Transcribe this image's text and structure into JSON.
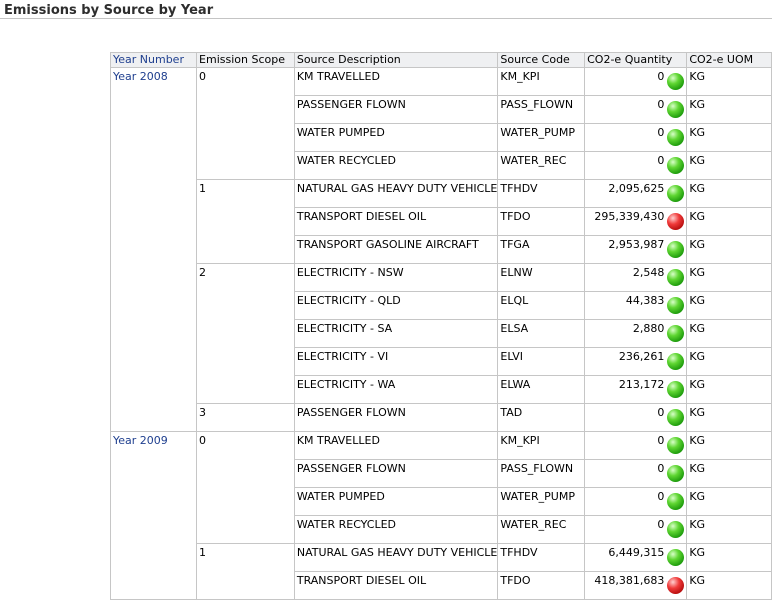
{
  "report": {
    "title": "Emissions by Source by Year"
  },
  "columns": [
    "Year Number",
    "Emission Scope",
    "Source Description",
    "Source Code",
    "CO2-e Quantity",
    "CO2-e UOM"
  ],
  "status_colors": {
    "green": "#3fbf1f",
    "red": "#e02020"
  },
  "groups": [
    {
      "year": "Year 2008",
      "scopes": [
        {
          "scope": "0",
          "rows": [
            {
              "desc": "KM TRAVELLED",
              "code": "KM_KPI",
              "qty": "0",
              "status": "green",
              "uom": "KG"
            },
            {
              "desc": "PASSENGER FLOWN",
              "code": "PASS_FLOWN",
              "qty": "0",
              "status": "green",
              "uom": "KG"
            },
            {
              "desc": "WATER PUMPED",
              "code": "WATER_PUMP",
              "qty": "0",
              "status": "green",
              "uom": "KG"
            },
            {
              "desc": "WATER RECYCLED",
              "code": "WATER_REC",
              "qty": "0",
              "status": "green",
              "uom": "KG"
            }
          ]
        },
        {
          "scope": "1",
          "rows": [
            {
              "desc": "NATURAL GAS HEAVY DUTY VEHICLE",
              "code": "TFHDV",
              "qty": "2,095,625",
              "status": "green",
              "uom": "KG"
            },
            {
              "desc": "TRANSPORT DIESEL OIL",
              "code": "TFDO",
              "qty": "295,339,430",
              "status": "red",
              "uom": "KG"
            },
            {
              "desc": "TRANSPORT GASOLINE AIRCRAFT",
              "code": "TFGA",
              "qty": "2,953,987",
              "status": "green",
              "uom": "KG"
            }
          ]
        },
        {
          "scope": "2",
          "rows": [
            {
              "desc": "ELECTRICITY - NSW",
              "code": "ELNW",
              "qty": "2,548",
              "status": "green",
              "uom": "KG"
            },
            {
              "desc": "ELECTRICITY - QLD",
              "code": "ELQL",
              "qty": "44,383",
              "status": "green",
              "uom": "KG"
            },
            {
              "desc": "ELECTRICITY - SA",
              "code": "ELSA",
              "qty": "2,880",
              "status": "green",
              "uom": "KG"
            },
            {
              "desc": "ELECTRICITY - VI",
              "code": "ELVI",
              "qty": "236,261",
              "status": "green",
              "uom": "KG"
            },
            {
              "desc": "ELECTRICITY - WA",
              "code": "ELWA",
              "qty": "213,172",
              "status": "green",
              "uom": "KG"
            }
          ]
        },
        {
          "scope": "3",
          "rows": [
            {
              "desc": "PASSENGER FLOWN",
              "code": "TAD",
              "qty": "0",
              "status": "green",
              "uom": "KG"
            }
          ]
        }
      ]
    },
    {
      "year": "Year 2009",
      "scopes": [
        {
          "scope": "0",
          "rows": [
            {
              "desc": "KM TRAVELLED",
              "code": "KM_KPI",
              "qty": "0",
              "status": "green",
              "uom": "KG"
            },
            {
              "desc": "PASSENGER FLOWN",
              "code": "PASS_FLOWN",
              "qty": "0",
              "status": "green",
              "uom": "KG"
            },
            {
              "desc": "WATER PUMPED",
              "code": "WATER_PUMP",
              "qty": "0",
              "status": "green",
              "uom": "KG"
            },
            {
              "desc": "WATER RECYCLED",
              "code": "WATER_REC",
              "qty": "0",
              "status": "green",
              "uom": "KG"
            }
          ]
        },
        {
          "scope": "1",
          "rows": [
            {
              "desc": "NATURAL GAS HEAVY DUTY VEHICLE",
              "code": "TFHDV",
              "qty": "6,449,315",
              "status": "green",
              "uom": "KG"
            },
            {
              "desc": "TRANSPORT DIESEL OIL",
              "code": "TFDO",
              "qty": "418,381,683",
              "status": "red",
              "uom": "KG"
            }
          ]
        }
      ]
    }
  ]
}
